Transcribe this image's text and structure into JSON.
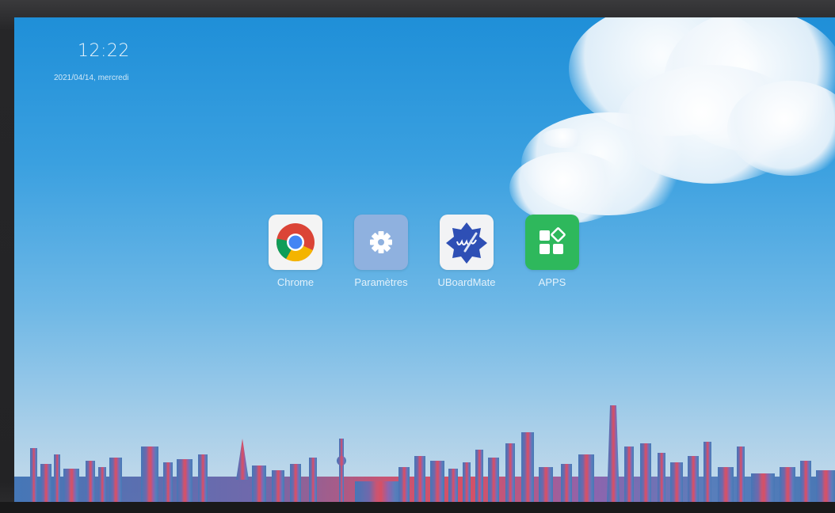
{
  "status": {
    "time": "12:22",
    "date": "2021/04/14, mercredi"
  },
  "apps": [
    {
      "label": "Chrome",
      "icon": "chrome-icon"
    },
    {
      "label": "Paramètres",
      "icon": "settings-gear-icon"
    },
    {
      "label": "UBoardMate",
      "icon": "uboardmate-icon"
    },
    {
      "label": "APPS",
      "icon": "apps-grid-icon"
    }
  ],
  "colors": {
    "sky_top": "#1f8fd8",
    "sky_bottom": "#c8dcea",
    "chrome_red": "#db4437",
    "chrome_green": "#0f9d58",
    "chrome_yellow": "#f4b400",
    "chrome_blue": "#4285f4",
    "settings_tile": "#8fb1df",
    "uboardmate_blue": "#2e4fb5",
    "apps_green": "#2eb85c"
  }
}
